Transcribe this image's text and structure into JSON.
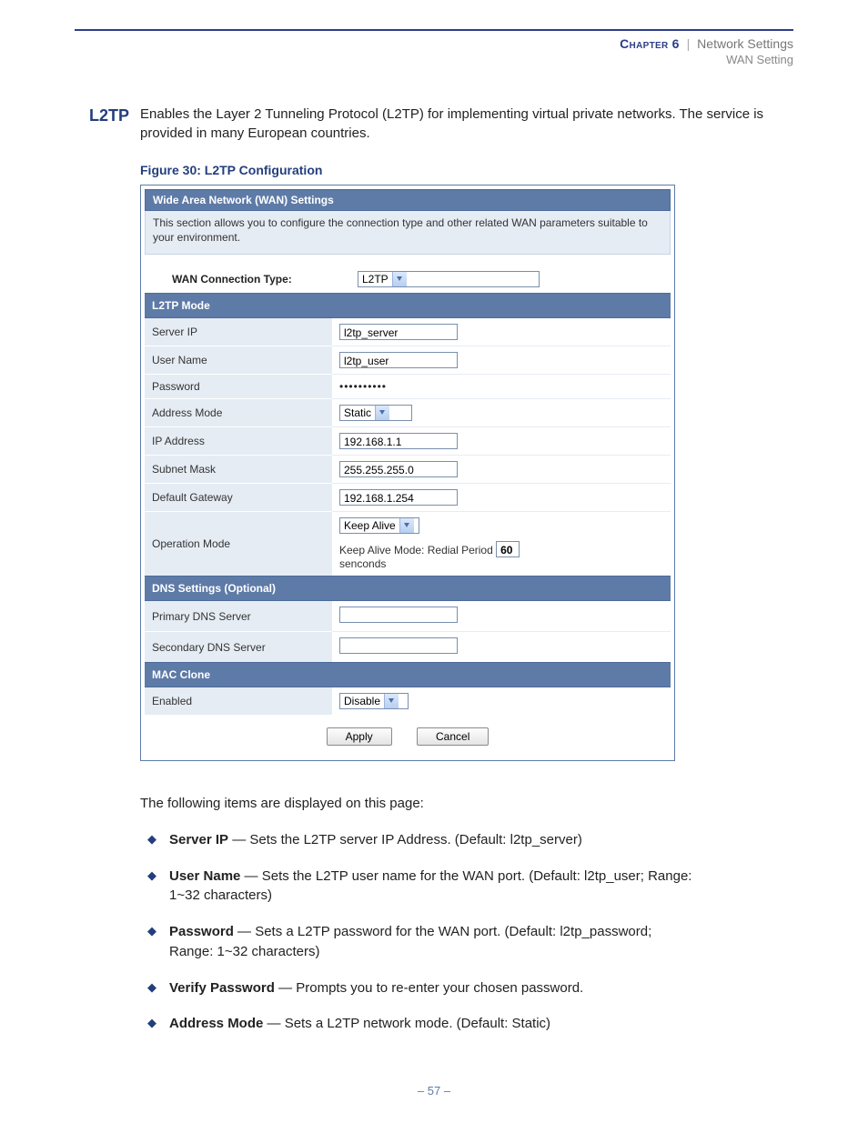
{
  "header": {
    "chapter": "Chapter 6",
    "separator": "|",
    "section": "Network Settings",
    "subsection": "WAN Setting"
  },
  "side_head": "L2TP",
  "intro": "Enables the Layer 2 Tunneling Protocol (L2TP) for implementing virtual private networks. The service is provided in many European countries.",
  "figure_caption": "Figure 30:  L2TP Configuration",
  "screenshot": {
    "title": "Wide Area Network (WAN) Settings",
    "desc": "This section allows you to configure the connection type and other related WAN parameters suitable to your environment.",
    "conn_label": "WAN Connection Type:",
    "conn_value": "L2TP",
    "section_l2tp": "L2TP Mode",
    "rows": {
      "server_ip": {
        "label": "Server IP",
        "value": "l2tp_server"
      },
      "user_name": {
        "label": "User Name",
        "value": "l2tp_user"
      },
      "password": {
        "label": "Password",
        "value": "••••••••••"
      },
      "address_mode": {
        "label": "Address Mode",
        "value": "Static"
      },
      "ip_address": {
        "label": "IP Address",
        "value": "192.168.1.1"
      },
      "subnet_mask": {
        "label": "Subnet Mask",
        "value": "255.255.255.0"
      },
      "default_gw": {
        "label": "Default Gateway",
        "value": "192.168.1.254"
      },
      "op_mode": {
        "label": "Operation Mode",
        "value": "Keep Alive",
        "redial_label_pre": "Keep Alive Mode: Redial Period",
        "redial_value": "60",
        "redial_label_post": "senconds"
      }
    },
    "section_dns": "DNS Settings (Optional)",
    "dns": {
      "primary": {
        "label": "Primary DNS Server",
        "value": ""
      },
      "secondary": {
        "label": "Secondary DNS Server",
        "value": ""
      }
    },
    "section_mac": "MAC Clone",
    "mac": {
      "enabled": {
        "label": "Enabled",
        "value": "Disable"
      }
    },
    "buttons": {
      "apply": "Apply",
      "cancel": "Cancel"
    }
  },
  "after_lead": "The following items are displayed on this page:",
  "bullets": [
    {
      "bold": "Server IP",
      "rest": " — Sets the L2TP server IP Address. (Default: l2tp_server)"
    },
    {
      "bold": "User Name",
      "rest": " — Sets the L2TP user name for the WAN port. (Default: l2tp_user; Range: 1~32 characters)"
    },
    {
      "bold": "Password",
      "rest": " — Sets a L2TP password for the WAN port. (Default: l2tp_password; Range: 1~32 characters)"
    },
    {
      "bold": "Verify Password",
      "rest": " — Prompts you to re-enter your chosen password."
    },
    {
      "bold": "Address Mode",
      "rest": " — Sets a L2TP network mode. (Default: Static)"
    }
  ],
  "page_number": "–  57  –"
}
